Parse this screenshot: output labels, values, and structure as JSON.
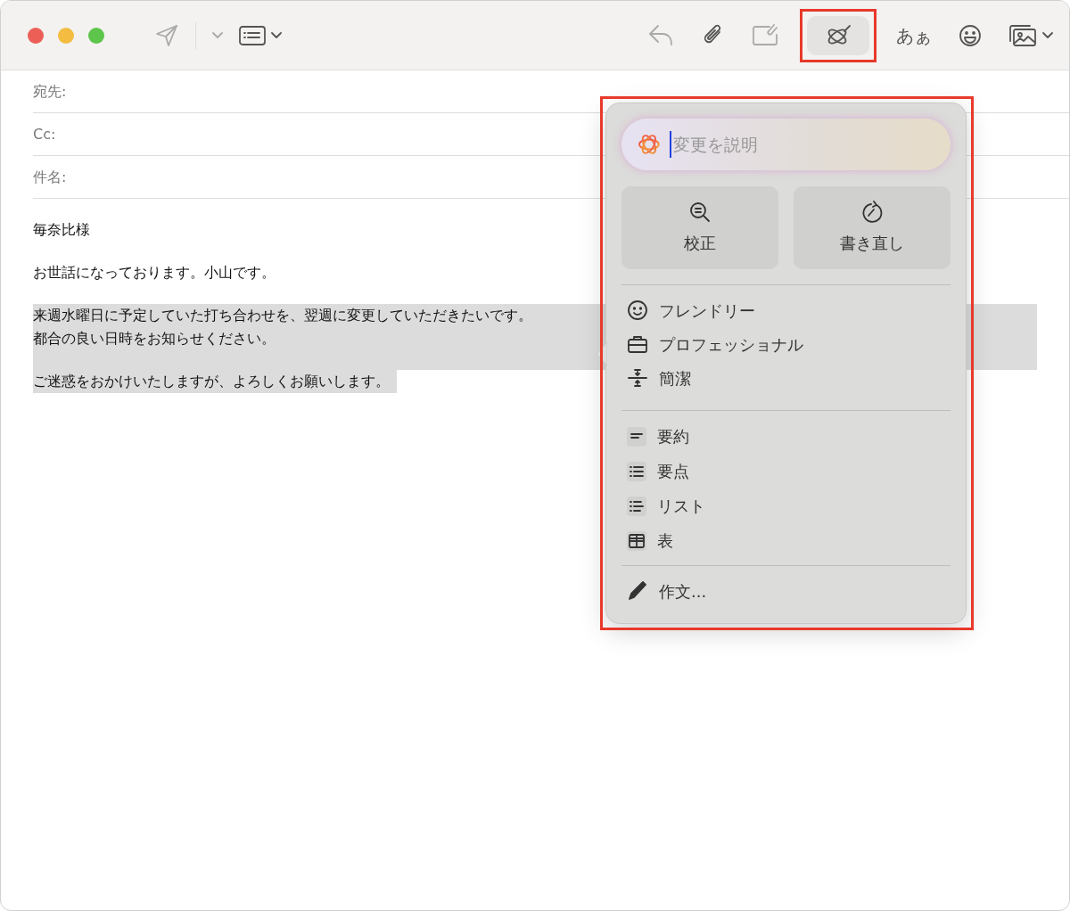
{
  "toolbar_left": [
    {
      "kind": "send",
      "disabled": true
    },
    {
      "kind": "divider"
    },
    {
      "kind": "caret",
      "disabled": true
    },
    {
      "kind": "header-format",
      "disabled": false
    },
    {
      "kind": "caret",
      "disabled": false
    }
  ],
  "toolbar_right": [
    {
      "kind": "reply",
      "disabled": true,
      "selected": false,
      "annotated": false
    },
    {
      "kind": "attach",
      "disabled": false,
      "selected": false,
      "annotated": false
    },
    {
      "kind": "markup",
      "disabled": true,
      "selected": false,
      "annotated": false
    },
    {
      "kind": "writing-tools",
      "disabled": false,
      "selected": true,
      "annotated": true
    },
    {
      "kind": "text",
      "label": "あぁ",
      "disabled": false,
      "selected": false,
      "annotated": false
    },
    {
      "kind": "emoji",
      "disabled": false,
      "selected": false,
      "annotated": false
    },
    {
      "kind": "photo",
      "disabled": false,
      "selected": false,
      "annotated": false
    },
    {
      "kind": "caret",
      "disabled": false,
      "selected": false,
      "annotated": false
    }
  ],
  "header_fields": [
    {
      "label": "宛先:"
    },
    {
      "label": "Cc:"
    },
    {
      "label": "件名:"
    }
  ],
  "body": [
    {
      "lines": [
        "毎奈比様"
      ],
      "selected": false
    },
    {
      "lines": [
        "お世話になっております。小山です。"
      ],
      "selected": false
    },
    {
      "lines": [
        "来週水曜日に予定していた打ち合わせを、翌週に変更していただきたいです。",
        "都合の良い日時をお知らせください。"
      ],
      "selected": true
    },
    {
      "lines": [
        "ご迷惑をおかけいたしますが、よろしくお願いします。"
      ],
      "selected": true
    }
  ],
  "writing_tools": {
    "annotated": true,
    "prompt": {
      "placeholder": "変更を説明"
    },
    "buttons": [
      {
        "kind": "proofread",
        "label": "校正"
      },
      {
        "kind": "rewrite",
        "label": "書き直し"
      }
    ],
    "groups": [
      [
        {
          "kind": "smile",
          "label": "フレンドリー"
        },
        {
          "kind": "briefcase",
          "label": "プロフェッショナル"
        },
        {
          "kind": "concise",
          "label": "簡潔"
        }
      ],
      [
        {
          "kind": "summary",
          "label": "要約"
        },
        {
          "kind": "key-points",
          "label": "要点"
        },
        {
          "kind": "list",
          "label": "リスト"
        },
        {
          "kind": "table",
          "label": "表"
        }
      ],
      [
        {
          "kind": "pencil",
          "label": "作文..."
        }
      ]
    ]
  }
}
